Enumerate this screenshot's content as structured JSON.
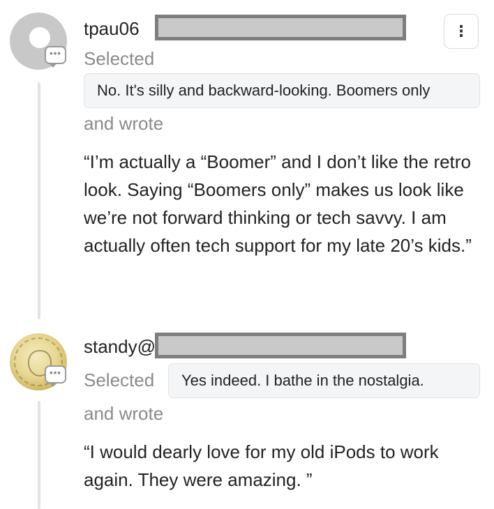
{
  "comments": [
    {
      "username_visible": "tpau06",
      "selected_label": "Selected",
      "choice": "No. It's silly and backward-looking. Boomers only",
      "wrote_label": "and wrote",
      "body": "“I’m actually a “Boomer” and I don’t like the retro look. Saying “Boomers only” makes us look like we’re not forward thinking or tech savvy. I am actually often tech support for my late 20’s kids.”",
      "avatar": "default-person-avatar",
      "badge_icon": "comment-bubble-icon"
    },
    {
      "username_visible": "standy@",
      "selected_label": "Selected",
      "choice": "Yes indeed. I bathe in the nostalgia.",
      "wrote_label": "and wrote",
      "body": "“I would dearly love for my old iPods to work again. They were amazing. ”",
      "avatar": "gold-coin-avatar",
      "badge_icon": "comment-bubble-icon"
    }
  ],
  "menu": {
    "icon": "more-vertical-icon",
    "glyph": "⋮"
  },
  "colors": {
    "muted_text": "#8a8a8a",
    "pill_background": "#f4f5f7",
    "redaction_fill": "#c9c9c9",
    "redaction_border": "#7d7d7d",
    "thread_line": "#e4e4e4"
  }
}
